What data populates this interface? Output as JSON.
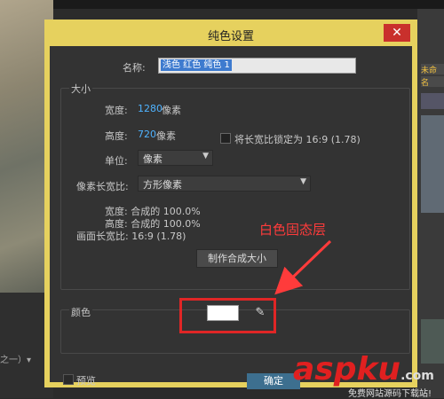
{
  "background": {
    "left_dropdown_fragment": "之一）▾",
    "right_tabs": [
      "未命",
      "名"
    ]
  },
  "dialog": {
    "title": "纯色设置",
    "close_icon": "✕",
    "name_label": "名称:",
    "name_value": "浅色 红色 纯色 1",
    "size_group_label": "大小",
    "width_label": "宽度:",
    "width_value": "1280",
    "width_unit": "像素",
    "height_label": "高度:",
    "height_value": "720",
    "height_unit": "像素",
    "lock_aspect_label": "将长宽比锁定为 16:9 (1.78)",
    "units_label": "单位:",
    "units_value": "像素",
    "pixel_aspect_label": "像素长宽比:",
    "pixel_aspect_value": "方形像素",
    "comp_width_line": "宽度: 合成的 100.0%",
    "comp_height_line": "高度: 合成的 100.0%",
    "frame_aspect_line": "画面长宽比: 16:9 (1.78)",
    "make_comp_size_button": "制作合成大小",
    "color_group_label": "颜色",
    "color_value": "#ffffff",
    "eyedropper_icon": "eyedropper-icon",
    "preview_label": "预览",
    "ok_button": "确定"
  },
  "annotation": {
    "text": "白色固态层",
    "color": "#ff3b3b"
  },
  "watermark": {
    "text": "aspku",
    "suffix": ".com",
    "sub": "免费网站源码下载站!"
  },
  "colors": {
    "dialog_frame": "#e6d15e",
    "client_bg": "#333333",
    "accent_value": "#4fb3ff",
    "highlight_box": "#e02626"
  }
}
